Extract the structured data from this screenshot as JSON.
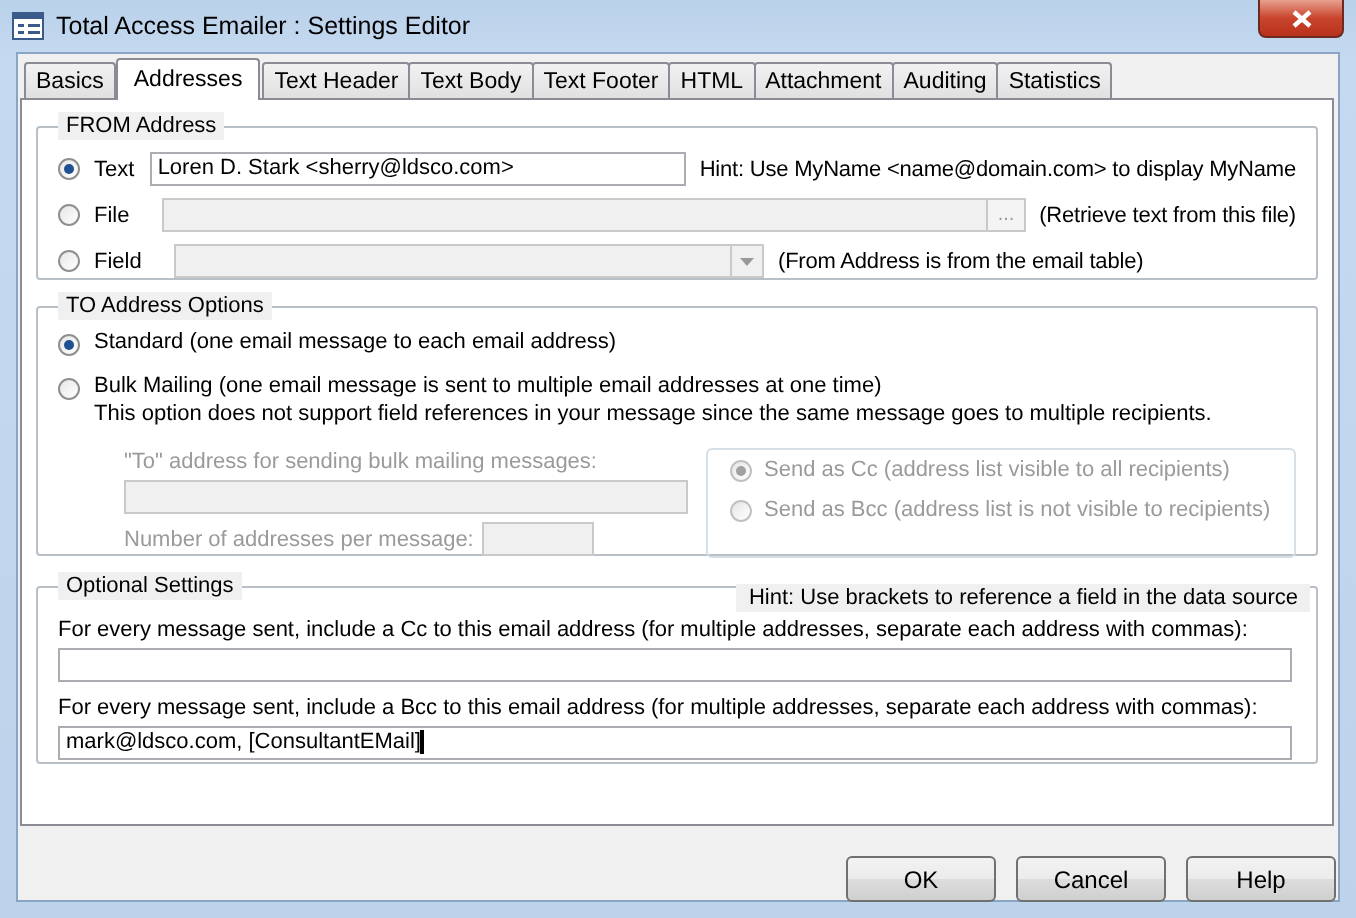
{
  "window": {
    "title": "Total Access Emailer : Settings Editor"
  },
  "tabs": [
    {
      "label": "Basics",
      "selected": false
    },
    {
      "label": "Addresses",
      "selected": true
    },
    {
      "label": "Text Header",
      "selected": false
    },
    {
      "label": "Text Body",
      "selected": false
    },
    {
      "label": "Text Footer",
      "selected": false
    },
    {
      "label": "HTML",
      "selected": false
    },
    {
      "label": "Attachment",
      "selected": false
    },
    {
      "label": "Auditing",
      "selected": false
    },
    {
      "label": "Statistics",
      "selected": false
    }
  ],
  "from_address": {
    "title": "FROM Address",
    "options": [
      {
        "kind": "text",
        "label": "Text",
        "selected": true,
        "value": "Loren D. Stark <sherry@ldsco.com>",
        "note": "Hint: Use MyName <name@domain.com> to display MyName"
      },
      {
        "kind": "file",
        "label": "File",
        "selected": false,
        "browse": "...",
        "note": "(Retrieve text from this file)"
      },
      {
        "kind": "field",
        "label": "Field",
        "selected": false,
        "note": "(From Address is from the email table)"
      }
    ]
  },
  "to_address": {
    "title": "TO Address Options",
    "options": [
      {
        "label": "Standard (one email message to each email address)",
        "selected": true
      },
      {
        "label": "Bulk Mailing (one email message is sent to multiple email addresses at one time)",
        "detail": "This option does not support field references in your message since the same message goes to multiple recipients.",
        "selected": false
      }
    ],
    "bulk": {
      "disabled": true,
      "to_label": "\"To\" address for sending bulk mailing messages:",
      "count_label": "Number of addresses per message:",
      "send_options": [
        {
          "label": "Send as Cc (address list visible to all recipients)",
          "selected": true
        },
        {
          "label": "Send as Bcc (address list is not visible to recipients)",
          "selected": false
        }
      ]
    }
  },
  "optional": {
    "title": "Optional Settings",
    "hint": "Hint: Use brackets to reference a field in the data source",
    "cc_label": "For every message sent, include a Cc to this email address (for multiple addresses, separate each address with commas):",
    "bcc_label": "For every message sent, include a Bcc to this email address (for multiple addresses, separate each address with commas):",
    "bcc_value": "mark@ldsco.com, [ConsultantEMail]"
  },
  "buttons": [
    "OK",
    "Cancel",
    "Help"
  ]
}
